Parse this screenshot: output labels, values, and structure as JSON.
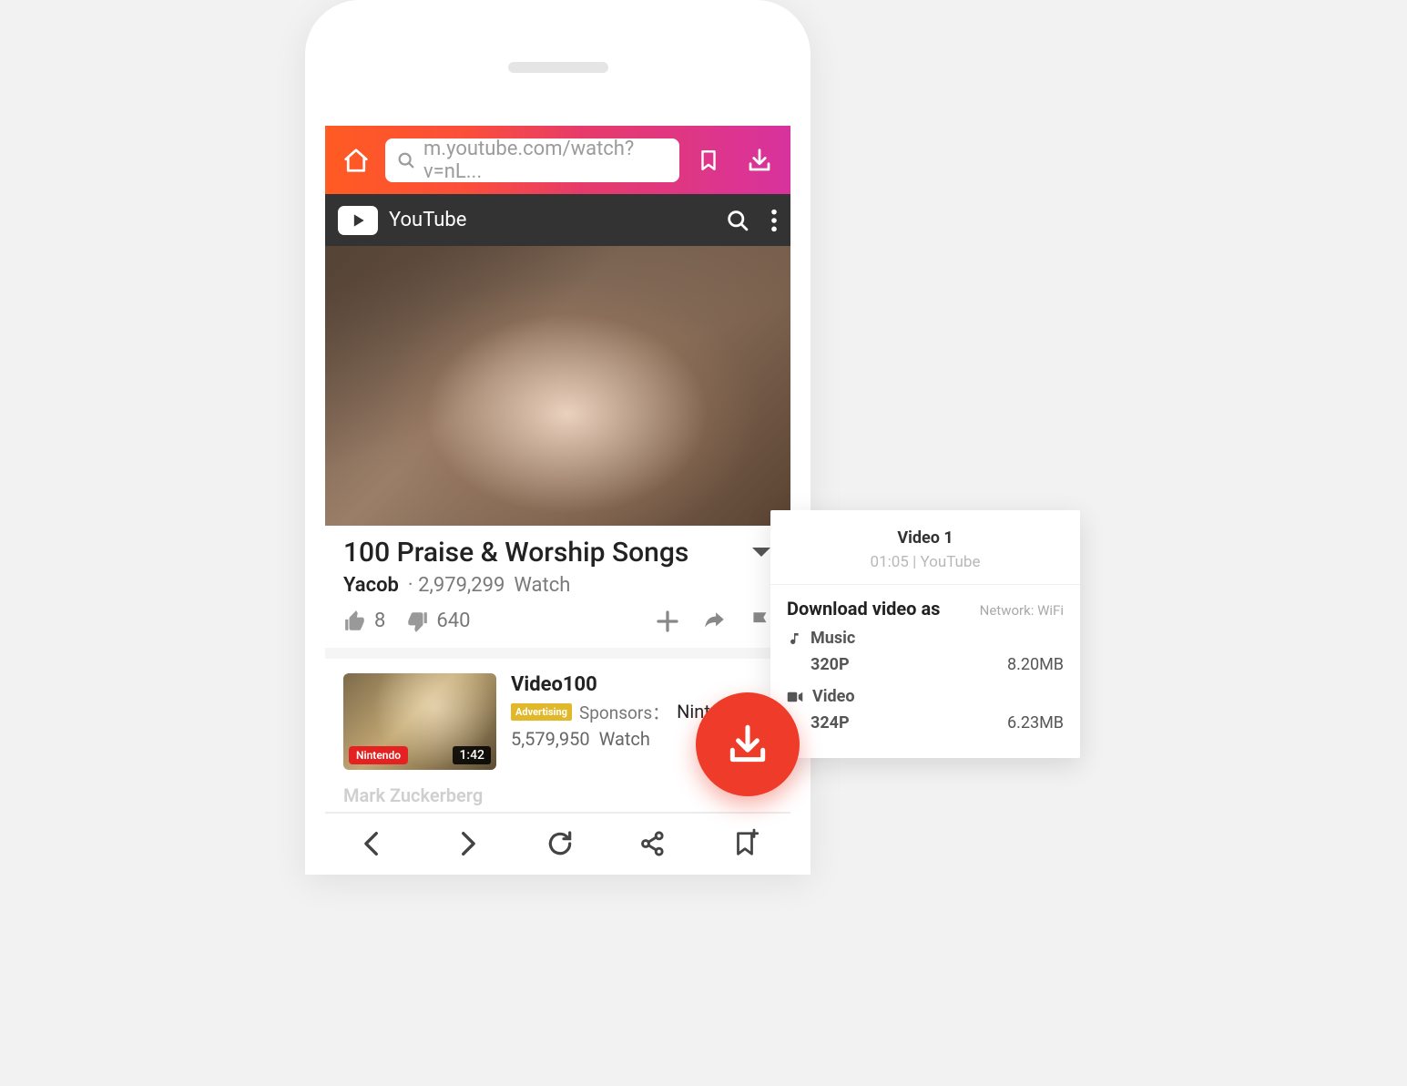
{
  "addressBar": {
    "url": "m.youtube.com/watch?v=nL..."
  },
  "youtubeBar": {
    "name": "YouTube"
  },
  "video": {
    "title": "100 Praise & Worship Songs",
    "author": "Yacob",
    "views": "2,979,299",
    "watchLabel": "Watch",
    "likes": "8",
    "dislikes": "640"
  },
  "related": {
    "title": "Video100",
    "adLabel": "Advertising",
    "sponsorsLabel": "Sponsors：",
    "sponsorName": "Nintendo",
    "views": "5,579,950",
    "watchLabel": "Watch",
    "brandBadge": "Nintendo",
    "duration": "1:42"
  },
  "cutoffLine": "Mark Zuckerberg",
  "fab": {
    "label": "Download"
  },
  "downloadPanel": {
    "title": "Video 1",
    "duration": "01:05",
    "source": "YouTube",
    "separator": " | ",
    "heading": "Download video as",
    "networkLabel": "Network:",
    "networkValue": "WiFi",
    "music": {
      "label": "Music",
      "quality": "320P",
      "size": "8.20MB"
    },
    "video": {
      "label": "Video",
      "quality": "324P",
      "size": "6.23MB"
    }
  }
}
